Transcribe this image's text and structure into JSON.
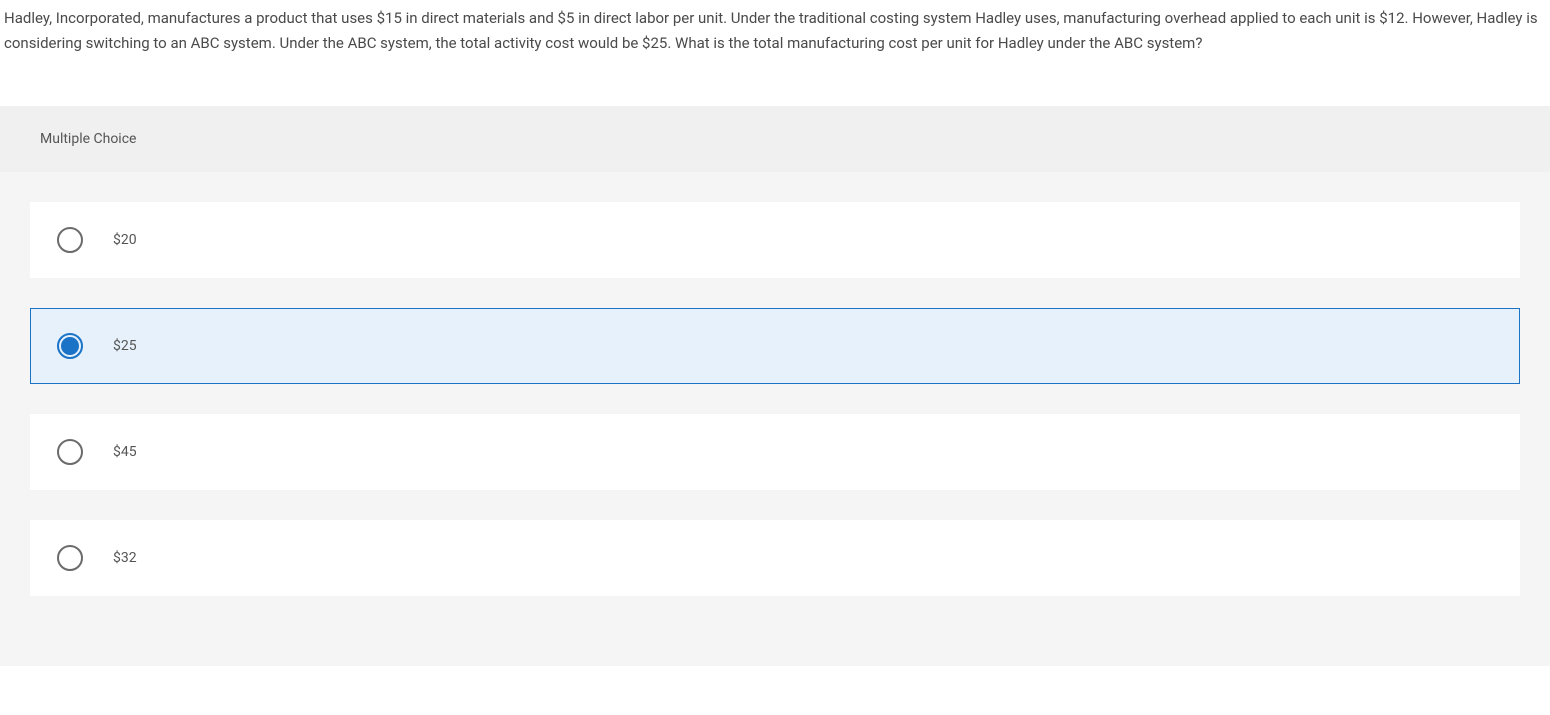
{
  "question": {
    "text": "Hadley, Incorporated, manufactures a product that uses $15 in direct materials and $5 in direct labor per unit. Under the traditional costing system Hadley uses, manufacturing overhead applied to each unit is $12. However, Hadley is considering switching to an ABC system. Under the ABC system, the total activity cost would be $25. What is the total manufacturing cost per unit for Hadley under the ABC system?"
  },
  "mc": {
    "header": "Multiple Choice",
    "options": [
      {
        "label": "$20",
        "selected": false
      },
      {
        "label": "$25",
        "selected": true
      },
      {
        "label": "$45",
        "selected": false
      },
      {
        "label": "$32",
        "selected": false
      }
    ]
  }
}
